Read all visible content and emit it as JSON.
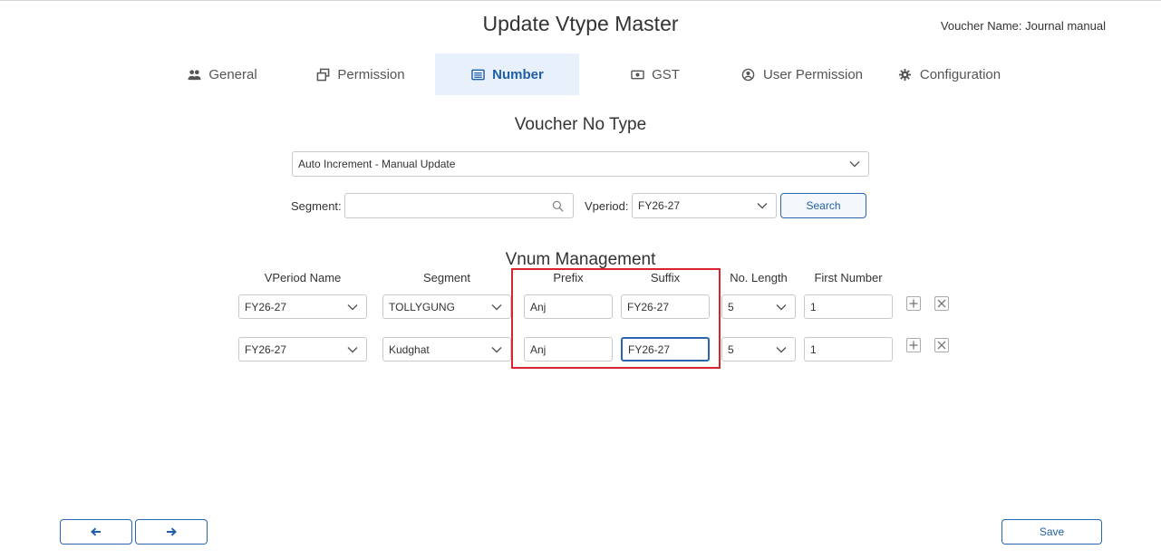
{
  "page": {
    "title": "Update Vtype Master",
    "voucher_name": "Voucher Name: Journal manual"
  },
  "tabs": [
    {
      "label": "General",
      "icon": "users-icon"
    },
    {
      "label": "Permission",
      "icon": "copy-icon"
    },
    {
      "label": "Number",
      "icon": "list-icon",
      "active": true
    },
    {
      "label": "GST",
      "icon": "money-icon"
    },
    {
      "label": "User Permission",
      "icon": "user-circle-icon"
    },
    {
      "label": "Configuration",
      "icon": "gear-icon"
    }
  ],
  "voucher_no_type": {
    "title": "Voucher No Type",
    "selected": "Auto Increment - Manual Update"
  },
  "filters": {
    "segment_label": "Segment:",
    "segment_value": "",
    "vperiod_label": "Vperiod:",
    "vperiod_value": "FY26-27",
    "search_label": "Search"
  },
  "vnum": {
    "title": "Vnum Management",
    "columns": [
      "VPeriod Name",
      "Segment",
      "Prefix",
      "Suffix",
      "No. Length",
      "First Number"
    ],
    "rows": [
      {
        "vperiod": "FY26-27",
        "segment": "TOLLYGUNG",
        "prefix": "Anj",
        "suffix": "FY26-27",
        "length": "5",
        "first_number": "1"
      },
      {
        "vperiod": "FY26-27",
        "segment": "Kudghat",
        "prefix": "Anj",
        "suffix": "FY26-27",
        "length": "5",
        "first_number": "1"
      }
    ]
  },
  "footer": {
    "prev_icon": "arrow-left-icon",
    "next_icon": "arrow-right-icon",
    "save_label": "Save"
  },
  "colors": {
    "accent": "#2a66b0",
    "active_tab_bg": "#e8f0fb",
    "highlight": "#d9232e"
  }
}
